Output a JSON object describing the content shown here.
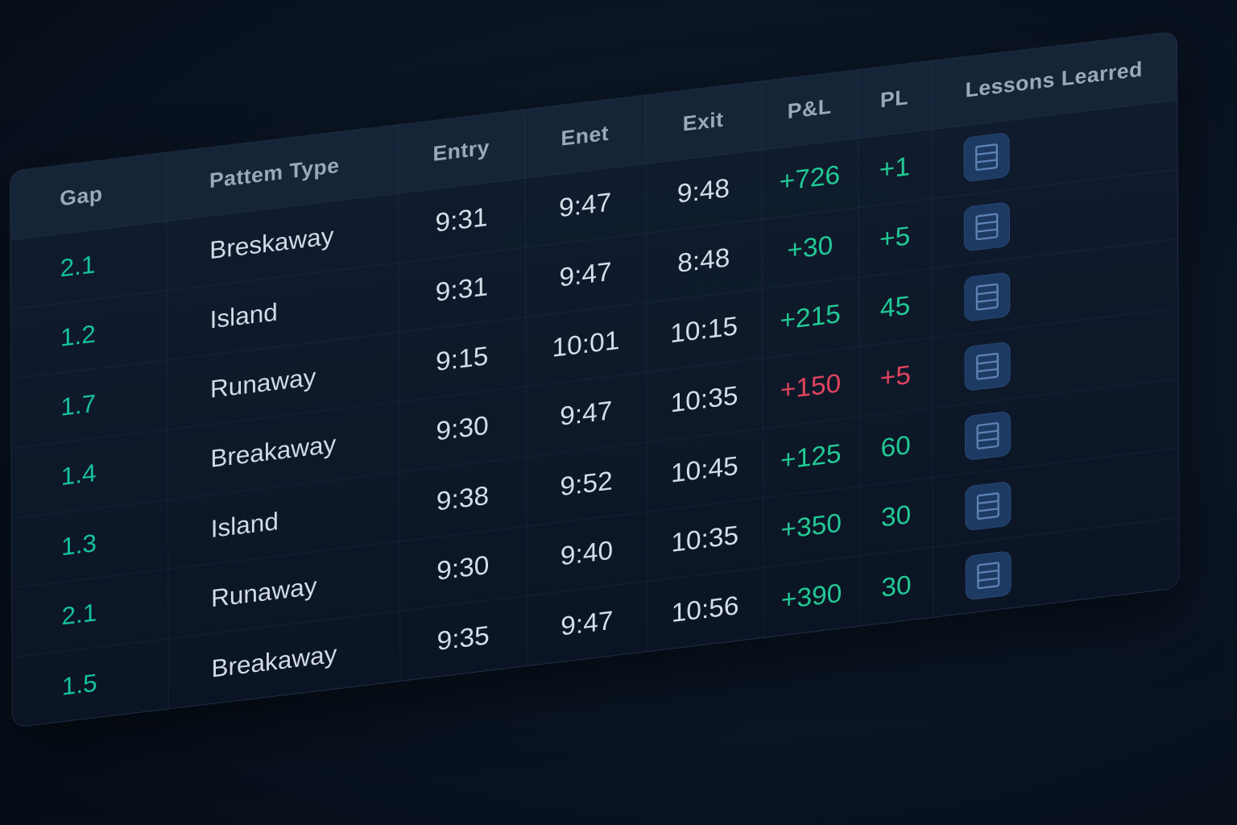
{
  "table": {
    "headers": {
      "gap": "Gap",
      "pattern": "Pattem Type",
      "entry": "Entry",
      "enet": "Enet",
      "exit": "Exit",
      "pnl": "P&L",
      "pl": "PL",
      "lessons": "Lessons Learred"
    },
    "rows": [
      {
        "gap": "2.1",
        "pattern": "Breskaway",
        "entry": "9:31",
        "enet": "9:47",
        "exit": "9:48",
        "pnl": "+726",
        "pl": "+1",
        "status": "positive"
      },
      {
        "gap": "1.2",
        "pattern": "Island",
        "entry": "9:31",
        "enet": "9:47",
        "exit": "8:48",
        "pnl": "+30",
        "pl": "+5",
        "status": "positive"
      },
      {
        "gap": "1.7",
        "pattern": "Runaway",
        "entry": "9:15",
        "enet": "10:01",
        "exit": "10:15",
        "pnl": "+215",
        "pl": "45",
        "status": "positive"
      },
      {
        "gap": "1.4",
        "pattern": "Breakaway",
        "entry": "9:30",
        "enet": "9:47",
        "exit": "10:35",
        "pnl": "+150",
        "pl": "+5",
        "status": "negative"
      },
      {
        "gap": "1.3",
        "pattern": "Island",
        "entry": "9:38",
        "enet": "9:52",
        "exit": "10:45",
        "pnl": "+125",
        "pl": "60",
        "status": "positive"
      },
      {
        "gap": "2.1",
        "pattern": "Runaway",
        "entry": "9:30",
        "enet": "9:40",
        "exit": "10:35",
        "pnl": "+350",
        "pl": "30",
        "status": "positive"
      },
      {
        "gap": "1.5",
        "pattern": "Breakaway",
        "entry": "9:35",
        "enet": "9:47",
        "exit": "10:56",
        "pnl": "+390",
        "pl": "30",
        "status": "positive"
      }
    ]
  },
  "icons": {
    "lessons_button": "notes-icon"
  },
  "colors": {
    "background": "#0a1422",
    "gap_text": "#16c2a3",
    "positive": "#22c995",
    "negative": "#e2435f",
    "icon_button": "#1d3a63"
  }
}
